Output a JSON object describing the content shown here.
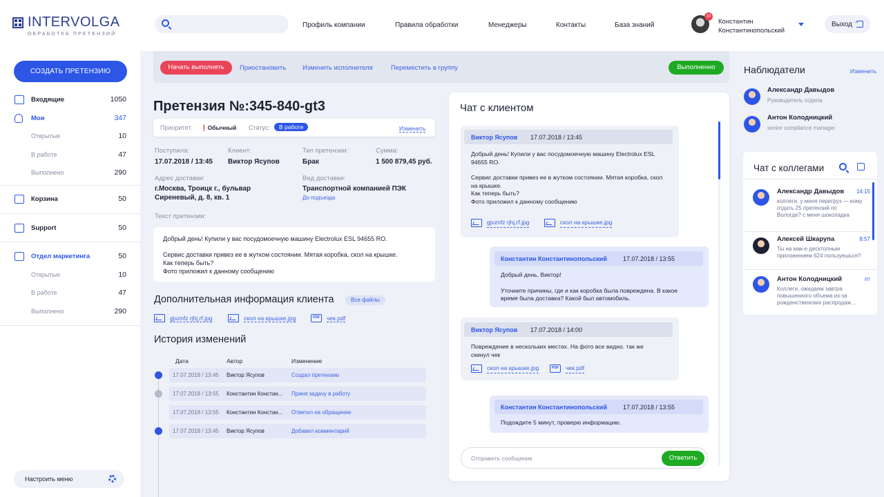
{
  "header": {
    "logo_main": "INTERVOLGA",
    "logo_sub": "ОБРАБОТКА ПРЕТЕНЗИЙ",
    "nav": [
      "Профиль компании",
      "Правила обработки",
      "Менеджеры",
      "Контакты",
      "База знаний"
    ],
    "notifications": "10",
    "user_first": "Константин",
    "user_last": "Константинопольский",
    "logout": "Выход"
  },
  "sidebar": {
    "create_label": "СОЗДАТЬ ПРЕТЕНЗИЮ",
    "inbox": {
      "label": "Входящие",
      "count": "1050"
    },
    "mine": {
      "label": "Мои",
      "count": "347"
    },
    "mine_sub": [
      {
        "label": "Открытые",
        "count": "10"
      },
      {
        "label": "В работе",
        "count": "47"
      },
      {
        "label": "Выполнено",
        "count": "290"
      }
    ],
    "trash": {
      "label": "Корзина",
      "count": "50"
    },
    "support": {
      "label": "Support",
      "count": "50"
    },
    "marketing": {
      "label": "Отдел маркетинга",
      "count": "50"
    },
    "marketing_sub": [
      {
        "label": "Открытые",
        "count": "10"
      },
      {
        "label": "В работе",
        "count": "47"
      },
      {
        "label": "Выполнено",
        "count": "290"
      }
    ],
    "config_label": "Настроить меню"
  },
  "actions": {
    "start": "Начать выполнять",
    "pause": "Приостановить",
    "change_assignee": "Изменить исполнителя",
    "move_group": "Переместить в группу",
    "done": "Выполненно"
  },
  "claim": {
    "title": "Претензия №:345-840-gt3",
    "priority_label": "Приоритет:",
    "priority_value": "Обычный",
    "status_label": "Статус:",
    "status_value": "В работе",
    "change_label": "Изменить",
    "received_label": "Поступила:",
    "received_value": "17.07.2018 / 13:45",
    "client_label": "Клиент:",
    "client_value": "Виктор Ясупов",
    "type_label": "Тип претензии:",
    "type_value": "Брак",
    "sum_label": "Сумма:",
    "sum_value": "1 500 879,45 руб.",
    "address_label": "Адрес доставки:",
    "address_line1": "г.Москва, Троицк г., бульвар",
    "address_line2": "Сиреневый, д. 8, кв. 1",
    "delivery_label": "Вид доставки:",
    "delivery_value": "Транспортной компанией ПЭК",
    "delivery_sub": "До подъезда",
    "text_label": "Текст претензии:",
    "text_p1": "Добрый день! Купили у вас посудомоечную машину Electrolux ESL 94655 RO.",
    "text_p2a": "Сервис доставки привез ее в жутком состоянии. Мятая коробка, скол на крышке.",
    "text_p2b": "Как теперь быть?",
    "text_p2c": "Фото приложил к данному сообщению",
    "extra_title": "Дополнительная информация клиента",
    "all_files": "Все файлы",
    "files": [
      "gjvznfz rjhj,rf.jpg",
      "скол на крышке.jpg",
      "чек.pdf"
    ],
    "history_title": "История изменений",
    "history_cols": [
      "Дата",
      "Автор",
      "Изменение"
    ],
    "history": [
      {
        "date": "17.07.2018 / 13:45",
        "author": "Виктор Ясупов",
        "change": "Создал претензию"
      },
      {
        "date": "17.07.2018 / 13:55",
        "author": "Константин Констан...",
        "change": "Приня задачу в работу"
      },
      {
        "date": "17.07.2018 / 13:55",
        "author": "Константин Констан...",
        "change": "Ответил на обращение"
      },
      {
        "date": "17.07.2018 / 13:45",
        "author": "Виктор Ясупов",
        "change": "Добавил комментарий"
      }
    ]
  },
  "chat": {
    "title": "Чат с клиентом",
    "m1": {
      "author": "Виктор Ясупов",
      "time": "17.07.2018 / 13:45",
      "l1": "Добрый день! Купили у вас посудомоечную машину Electrolux ESL",
      "l2": "94655 RO.",
      "l3": "Сервис доставки привез ее в жутком состоянии. Мятая коробка, скол",
      "l4": "на крышке.",
      "l5": "Как теперь быть?",
      "l6": "Фото приложил к данному сообщению",
      "f1": "gjvznfz rjhj,rf.jpg",
      "f2": "скол на крышке.jpg"
    },
    "m2": {
      "author": "Константин Константинопольский",
      "time": "17.07.2018 / 13:55",
      "l1": "Добрый день, Виктор!",
      "l2": "Уточните причины, где и как коробка была повреждена. В какое",
      "l3": "время была доставка? Какой был автомобиль."
    },
    "m3": {
      "author": "Виктор Ясупов",
      "time": "17.07.2018 / 14:00",
      "l1": "Повреждение в нескольких местах. На фото все видно. так же",
      "l2": "скинул чек",
      "f1": "скол на крышке.jpg",
      "f2": "чек.pdf"
    },
    "m4": {
      "author": "Константин Константинопольский",
      "time": "17.07.2018 / 13:55",
      "l1": "Подождите 5 минут, проверю информацию."
    },
    "placeholder": "Отправить сообщение",
    "send": "Ответить"
  },
  "observers": {
    "title": "Наблюдатели",
    "change": "Изменить",
    "list": [
      {
        "name": "Александр Давыдов",
        "role": "Руководитель отдела"
      },
      {
        "name": "Антон Колодницкий",
        "role": "senior compliance manager"
      }
    ]
  },
  "colleagues": {
    "title": "Чат с коллегами",
    "list": [
      {
        "name": "Александр Давыдов",
        "time": "14:15",
        "l1": "коллеги, у меня перегруз — кому",
        "l2": "отдать 25 претензий по",
        "l3": "Вологде? с меня шоколадка"
      },
      {
        "name": "Алексей Шкарупа",
        "time": "8:57",
        "l1": "Ты на мак-е десктопным",
        "l2": "приложением 624 пользуешься?",
        "l3": ""
      },
      {
        "name": "Антон Колодницкий",
        "time": "пт",
        "l1": "Коллеги, ожидаем завтра",
        "l2": "повышенного объема из-за",
        "l3": "рожденственских распродаж..."
      }
    ]
  },
  "colors": {
    "accent": "#2d56e6",
    "danger": "#ea4459",
    "success": "#1eaa22"
  }
}
